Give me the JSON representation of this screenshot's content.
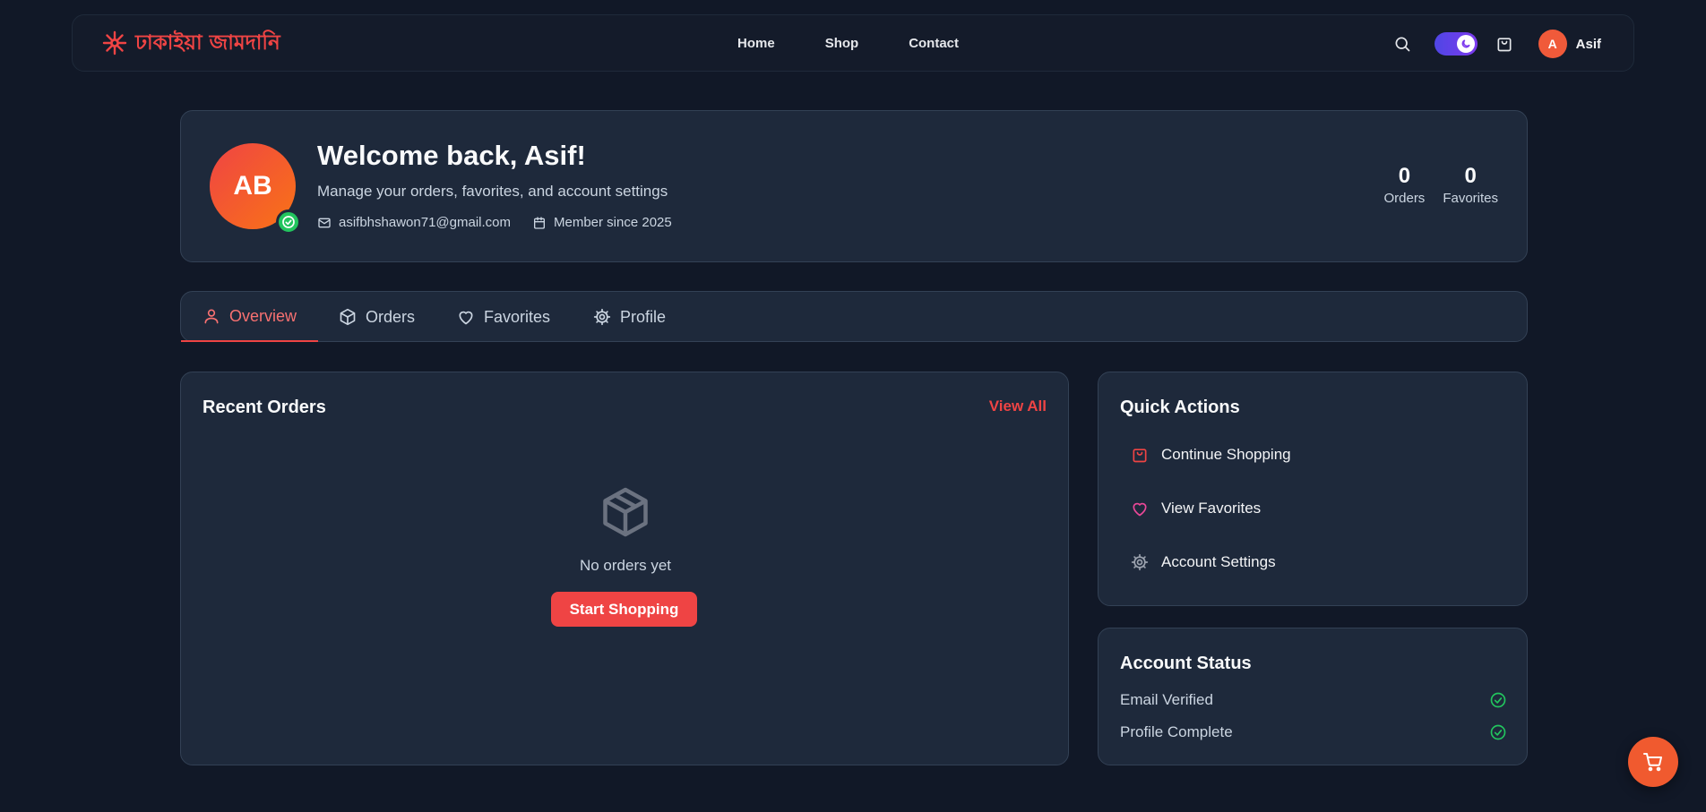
{
  "nav": {
    "brand": "ঢাকাইয়া জামদানি",
    "links": [
      "Home",
      "Shop",
      "Contact"
    ],
    "user_initial": "A",
    "user_name": "Asif"
  },
  "welcome": {
    "avatar_initials": "AB",
    "title": "Welcome back, Asif!",
    "subtitle": "Manage your orders, favorites, and account settings",
    "email": "asifbhshawon71@gmail.com",
    "member_since": "Member since 2025",
    "stats": [
      {
        "value": "0",
        "label": "Orders"
      },
      {
        "value": "0",
        "label": "Favorites"
      }
    ]
  },
  "tabs": [
    {
      "label": "Overview",
      "icon": "user-icon",
      "active": true
    },
    {
      "label": "Orders",
      "icon": "package-icon",
      "active": false
    },
    {
      "label": "Favorites",
      "icon": "heart-icon",
      "active": false
    },
    {
      "label": "Profile",
      "icon": "gear-icon",
      "active": false
    }
  ],
  "recent_orders": {
    "title": "Recent Orders",
    "view_all": "View All",
    "empty_text": "No orders yet",
    "cta": "Start Shopping"
  },
  "quick_actions": {
    "title": "Quick Actions",
    "items": [
      {
        "label": "Continue Shopping",
        "icon": "shopping-bag-icon"
      },
      {
        "label": "View Favorites",
        "icon": "heart-icon"
      },
      {
        "label": "Account Settings",
        "icon": "gear-icon"
      }
    ]
  },
  "account_status": {
    "title": "Account Status",
    "rows": [
      {
        "label": "Email Verified",
        "icon": "check-circle-icon"
      },
      {
        "label": "Profile Complete",
        "icon": "check-circle-icon"
      }
    ]
  },
  "colors": {
    "background": "#111827",
    "card": "#1e293b",
    "accent": "#ef4444",
    "success": "#22c55e"
  }
}
